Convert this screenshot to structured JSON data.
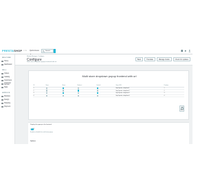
{
  "topbar": {
    "logo_prefix": "PRESTA",
    "logo_suffix": "SHOP",
    "version": "1.7.8",
    "quick_access": "Quick Access",
    "search_value": "Search",
    "right_items": [
      "View my shop",
      "Notifications",
      "Account"
    ]
  },
  "sidebar": {
    "sections": [
      {
        "label": "WELCOME",
        "items": [
          "Home",
          "Dashboard"
        ]
      },
      {
        "label": "SELL",
        "items": [
          "Orders",
          "Catalog",
          "Customers",
          "Customer Service",
          "Stats"
        ]
      },
      {
        "label": "IMPROVE",
        "items": [
          "Modules",
          "Design",
          "Shipping",
          "Payment"
        ]
      }
    ]
  },
  "header": {
    "breadcrumb": "Module Manager  /  Configure",
    "title": "Configure",
    "subtitle": "Multi store dropdown popup frontend with url",
    "buttons": [
      "Back",
      "Translate",
      "Manage hooks",
      "Check for updates"
    ]
  },
  "panel": {
    "title": "Multi store dropdown popup frontend with url",
    "columns": [
      "ID",
      "Store",
      "Show",
      "Redirect",
      "Default",
      "Store URL",
      "Position"
    ],
    "rows": [
      {
        "id": "1",
        "store": "",
        "show": true,
        "redirect": false,
        "default": true,
        "url": "http://presta..shop/store1",
        "position": "1"
      },
      {
        "id": "2",
        "store": "",
        "show": false,
        "redirect": true,
        "default": false,
        "url": "http://presta..shop/store2",
        "position": "2"
      },
      {
        "id": "3",
        "store": "",
        "show": true,
        "redirect": false,
        "default": true,
        "url": "http://presta..shop/store3",
        "position": "3"
      },
      {
        "id": "4",
        "store": "",
        "show": false,
        "redirect": false,
        "default": false,
        "url": "http://presta..shop/store4",
        "position": "4"
      }
    ],
    "save_label": "Save"
  },
  "lower": {
    "label": "Display this popup in the frontend",
    "toggle_yes": "YES",
    "toggle_no": "NO",
    "hint": "Enable or disable the multi store popup",
    "section": "Options"
  },
  "colors": {
    "accent": "#25b9d7",
    "text": "#363a41",
    "background": "#eff1f2"
  }
}
